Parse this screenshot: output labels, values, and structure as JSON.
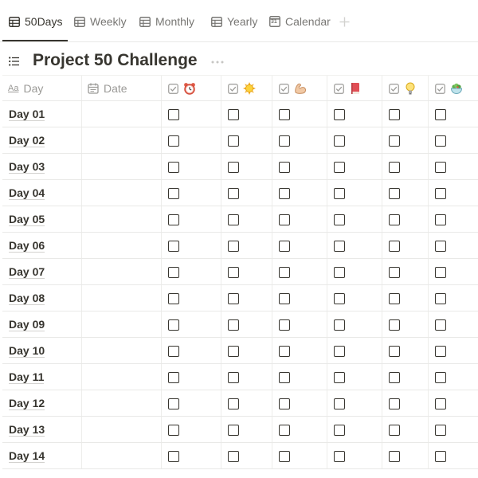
{
  "tabs": [
    {
      "label": "50Days",
      "icon": "table-icon",
      "active": true
    },
    {
      "label": "Weekly",
      "icon": "table-icon",
      "active": false
    },
    {
      "label": "Monthly",
      "icon": "table-icon",
      "active": false
    },
    {
      "label": "Yearly",
      "icon": "table-icon",
      "active": false
    },
    {
      "label": "Calendar",
      "icon": "calendar-icon",
      "active": false
    }
  ],
  "calendar_icon_text": "31",
  "title": "Project 50 Challenge",
  "columns": {
    "day": {
      "label": "Day",
      "type_icon": "text-type-icon",
      "type_icon_text": "Aa"
    },
    "date": {
      "label": "Date",
      "type_icon": "calendar-icon"
    },
    "habits": [
      {
        "icon": "alarm-clock-icon"
      },
      {
        "icon": "sun-icon"
      },
      {
        "icon": "flexed-biceps-icon"
      },
      {
        "icon": "red-book-icon"
      },
      {
        "icon": "light-bulb-icon"
      },
      {
        "icon": "salad-bowl-icon"
      }
    ]
  },
  "rows": [
    {
      "day": "Day 01",
      "checks": [
        false,
        false,
        false,
        false,
        false,
        false
      ]
    },
    {
      "day": "Day 02",
      "checks": [
        false,
        false,
        false,
        false,
        false,
        false
      ]
    },
    {
      "day": "Day 03",
      "checks": [
        false,
        false,
        false,
        false,
        false,
        false
      ]
    },
    {
      "day": "Day 04",
      "checks": [
        false,
        false,
        false,
        false,
        false,
        false
      ]
    },
    {
      "day": "Day 05",
      "checks": [
        false,
        false,
        false,
        false,
        false,
        false
      ]
    },
    {
      "day": "Day 06",
      "checks": [
        false,
        false,
        false,
        false,
        false,
        false
      ]
    },
    {
      "day": "Day 07",
      "checks": [
        false,
        false,
        false,
        false,
        false,
        false
      ]
    },
    {
      "day": "Day 08",
      "checks": [
        false,
        false,
        false,
        false,
        false,
        false
      ]
    },
    {
      "day": "Day 09",
      "checks": [
        false,
        false,
        false,
        false,
        false,
        false
      ]
    },
    {
      "day": "Day 10",
      "checks": [
        false,
        false,
        false,
        false,
        false,
        false
      ]
    },
    {
      "day": "Day 11",
      "checks": [
        false,
        false,
        false,
        false,
        false,
        false
      ]
    },
    {
      "day": "Day 12",
      "checks": [
        false,
        false,
        false,
        false,
        false,
        false
      ]
    },
    {
      "day": "Day 13",
      "checks": [
        false,
        false,
        false,
        false,
        false,
        false
      ]
    },
    {
      "day": "Day 14",
      "checks": [
        false,
        false,
        false,
        false,
        false,
        false
      ]
    }
  ],
  "colors": {
    "text": "#37352f",
    "muted": "#9b9a97",
    "border": "#e9e9e7"
  }
}
